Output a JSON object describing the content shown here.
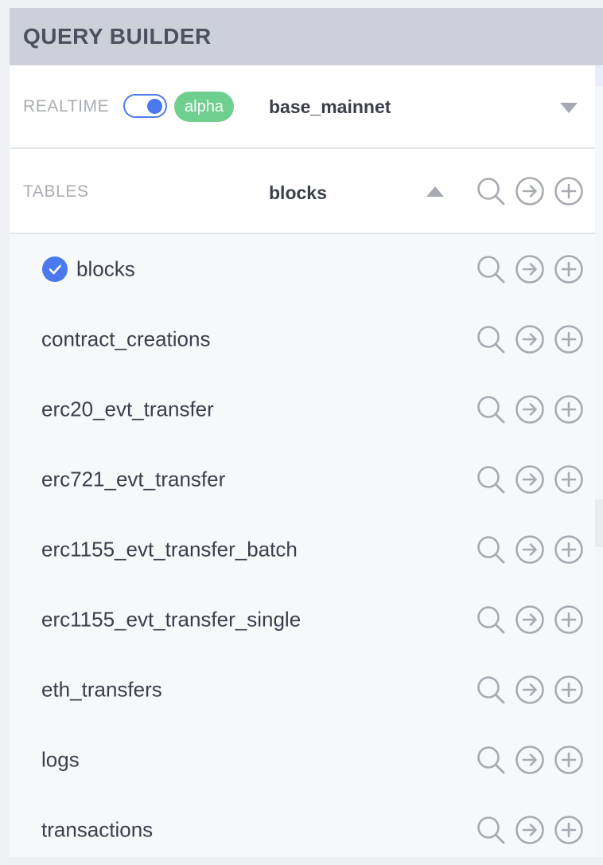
{
  "header": {
    "title": "QUERY BUILDER"
  },
  "realtime": {
    "label": "REALTIME",
    "toggle_on": true,
    "badge": "alpha",
    "network": "base_mainnet",
    "network_icon": "chevron-down-icon"
  },
  "tables": {
    "label": "TABLES",
    "selected": "blocks",
    "toggle_icon": "chevron-up-icon",
    "actions": [
      "search-icon",
      "arrow-right-circle-icon",
      "plus-circle-icon"
    ]
  },
  "list": {
    "items": [
      {
        "label": "blocks",
        "selected": true
      },
      {
        "label": "contract_creations",
        "selected": false
      },
      {
        "label": "erc20_evt_transfer",
        "selected": false
      },
      {
        "label": "erc721_evt_transfer",
        "selected": false
      },
      {
        "label": "erc1155_evt_transfer_batch",
        "selected": false
      },
      {
        "label": "erc1155_evt_transfer_single",
        "selected": false
      },
      {
        "label": "eth_transfers",
        "selected": false
      },
      {
        "label": "logs",
        "selected": false
      },
      {
        "label": "transactions",
        "selected": false
      }
    ]
  },
  "colors": {
    "accent": "#4a78ef",
    "badge": "#6fcf8e",
    "header_bg": "#cdd0d8",
    "icon": "#a7aab1"
  }
}
